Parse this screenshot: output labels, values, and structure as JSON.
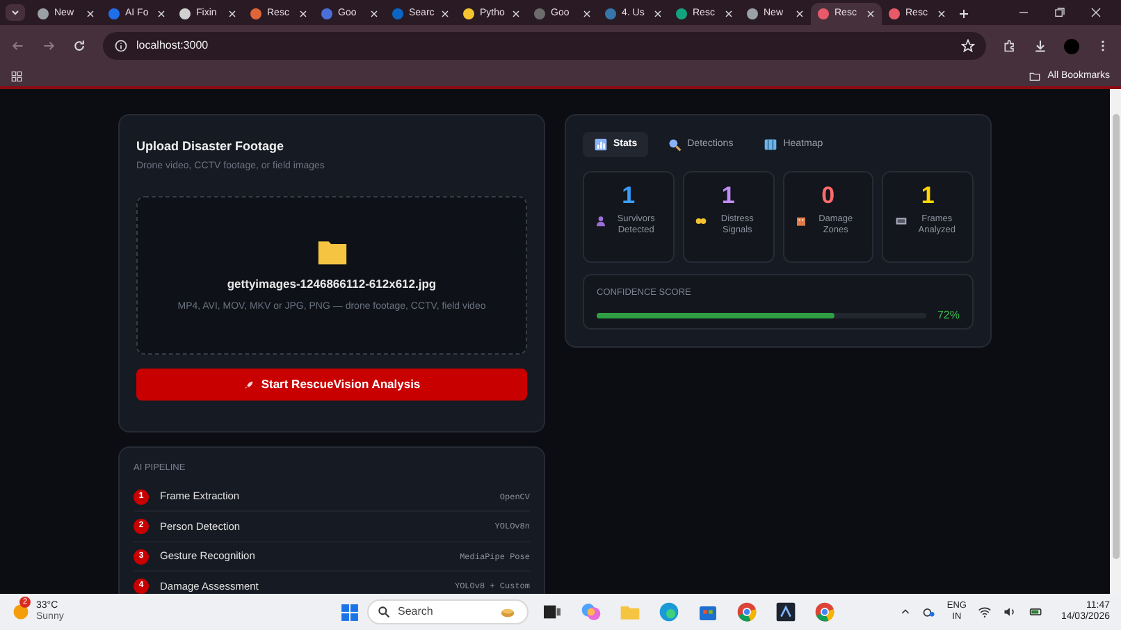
{
  "browser": {
    "tabs": [
      {
        "title": "New",
        "selected": false,
        "color": "#9aa0a6"
      },
      {
        "title": "AI Fo",
        "selected": false,
        "color": "#1f6feb"
      },
      {
        "title": "Fixin",
        "selected": false,
        "color": "#d0d0d0"
      },
      {
        "title": "Resc",
        "selected": false,
        "color": "#e0663a"
      },
      {
        "title": "Goo",
        "selected": false,
        "color": "#4a6fd8"
      },
      {
        "title": "Searc",
        "selected": false,
        "color": "#0a66c2"
      },
      {
        "title": "Pytho",
        "selected": false,
        "color": "#f4c430"
      },
      {
        "title": "Goo",
        "selected": false,
        "color": "#6b6b6b"
      },
      {
        "title": "4. Us",
        "selected": false,
        "color": "#3776ab"
      },
      {
        "title": "Resc",
        "selected": false,
        "color": "#14a37f"
      },
      {
        "title": "New",
        "selected": false,
        "color": "#9aa0a6"
      },
      {
        "title": "Resc",
        "selected": true,
        "color": "#e85a6a"
      },
      {
        "title": "Resc",
        "selected": false,
        "color": "#e85a6a"
      }
    ],
    "address": "localhost:3000",
    "bookmarks": "All Bookmarks"
  },
  "upload": {
    "title": "Upload Disaster Footage",
    "subtitle": "Drone video, CCTV footage, or field images",
    "file_name": "gettyimages-1246866112-612x612.jpg",
    "formats": "MP4, AVI, MOV, MKV or JPG, PNG — drone footage, CCTV, field video",
    "button": "Start RescueVision Analysis"
  },
  "pipeline": {
    "title": "AI PIPELINE",
    "steps": [
      {
        "number": "1",
        "name": "Frame Extraction",
        "tool": "OpenCV"
      },
      {
        "number": "2",
        "name": "Person Detection",
        "tool": "YOLOv8n"
      },
      {
        "number": "3",
        "name": "Gesture Recognition",
        "tool": "MediaPipe Pose"
      },
      {
        "number": "4",
        "name": "Damage Assessment",
        "tool": "YOLOv8 + Custom"
      }
    ]
  },
  "results": {
    "tabs": [
      {
        "label": "Stats",
        "selected": true
      },
      {
        "label": "Detections",
        "selected": false
      },
      {
        "label": "Heatmap",
        "selected": false
      }
    ],
    "stats": [
      {
        "value": "1",
        "label": "Survivors Detected",
        "color": "#3b9cff"
      },
      {
        "value": "1",
        "label": "Distress Signals",
        "color": "#c18cf5"
      },
      {
        "value": "0",
        "label": "Damage Zones",
        "color": "#ff6b6b"
      },
      {
        "value": "1",
        "label": "Frames Analyzed",
        "color": "#ffd600"
      }
    ],
    "confidence": {
      "label": "CONFIDENCE SCORE",
      "level": 0.72,
      "reading": "72%"
    }
  },
  "taskbar": {
    "weather_badge": "2",
    "temperature": "33°C",
    "condition": "Sunny",
    "search": "Search",
    "language": "ENG",
    "region": "IN",
    "time": "11:47",
    "date": "14/03/2026"
  }
}
